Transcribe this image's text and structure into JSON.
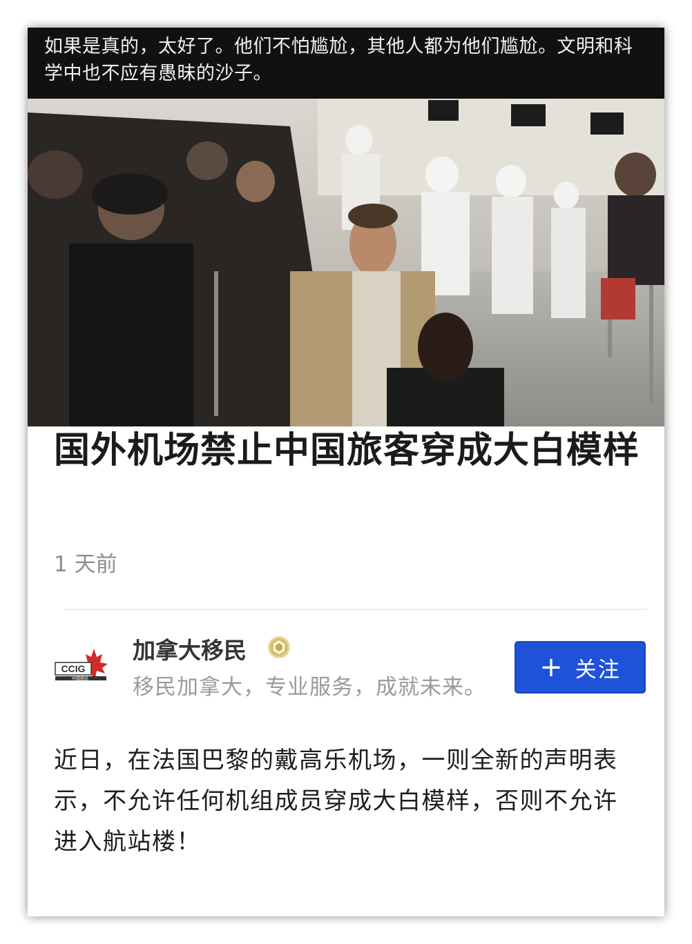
{
  "caption": {
    "text": "如果是真的，太好了。他们不怕尴尬，其他人都为他们尴尬。文明和科学中也不应有愚昧的沙子。"
  },
  "article": {
    "headline": "国外机场禁止中国旅客穿成大白模样",
    "timestamp": "1 天前",
    "body": "近日，在法国巴黎的戴高乐机场，一则全新的声明表示，不允许任何机组成员穿成大白模样，否则不允许进入航站楼！"
  },
  "author": {
    "name": "加拿大移民",
    "description": "移民加拿大，专业服务，成就未来。",
    "logo_text": "CCIG",
    "logo_subtext": "中國移民",
    "verified_icon": "verified-badge-icon"
  },
  "follow": {
    "plus": "+",
    "label": "关注",
    "color": "#1e52d8"
  },
  "colors": {
    "caption_bg": "#111111",
    "headline": "#1b1b1b",
    "timestamp": "#8d8d8d"
  }
}
